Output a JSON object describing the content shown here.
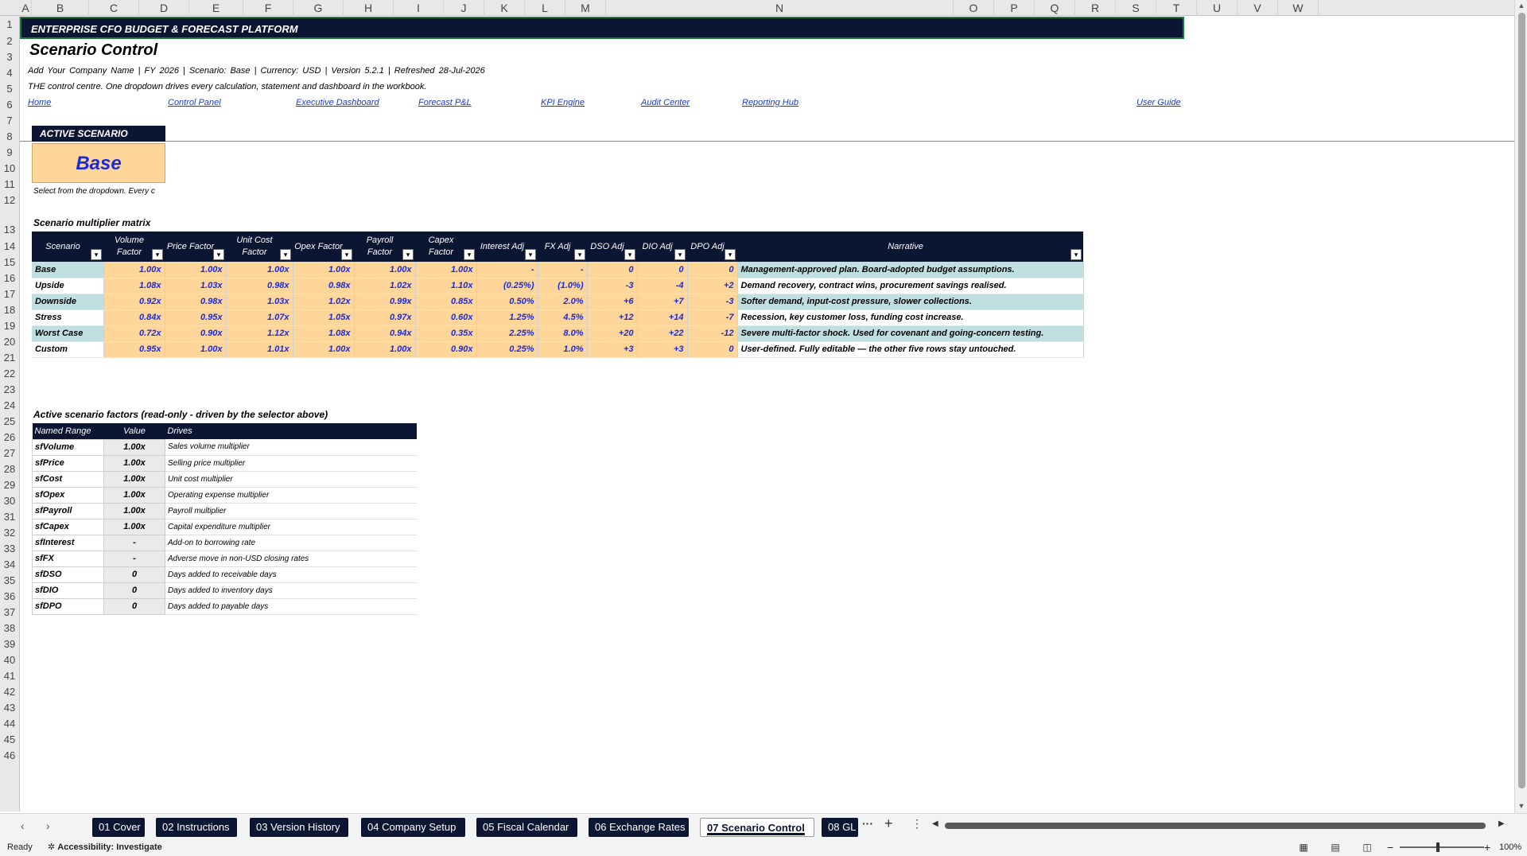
{
  "columns": [
    "A",
    "B",
    "C",
    "D",
    "E",
    "F",
    "G",
    "H",
    "I",
    "J",
    "K",
    "L",
    "M",
    "N",
    "O",
    "P",
    "Q",
    "R",
    "S",
    "T",
    "U",
    "V",
    "W"
  ],
  "rows": [
    "1",
    "2",
    "3",
    "4",
    "5",
    "6",
    "7",
    "8",
    "9",
    "10",
    "11",
    "12",
    "13",
    "14",
    "15",
    "16",
    "17",
    "18",
    "19",
    "20",
    "21",
    "22",
    "23",
    "24",
    "25",
    "26",
    "27",
    "28",
    "29",
    "30",
    "31",
    "32",
    "33",
    "34",
    "35",
    "36",
    "37",
    "38",
    "39",
    "40",
    "41",
    "42",
    "43",
    "44",
    "45",
    "46"
  ],
  "header": {
    "banner": "ENTERPRISE CFO BUDGET & FORECAST PLATFORM",
    "title": "Scenario Control",
    "meta": "Add Your Company Name   |   FY 2026   |   Scenario: Base   |   Currency: USD   |   Version 5.2.1   |   Refreshed 28-Jul-2026",
    "description": "THE control centre. One dropdown drives every calculation, statement and dashboard in the workbook."
  },
  "nav": [
    {
      "label": "Home"
    },
    {
      "label": "Control Panel"
    },
    {
      "label": "Executive Dashboard"
    },
    {
      "label": "Forecast P&L"
    },
    {
      "label": "KPI Engine"
    },
    {
      "label": "Audit Center"
    },
    {
      "label": "Reporting Hub"
    },
    {
      "label": "User Guide"
    }
  ],
  "active_scenario": {
    "label": "ACTIVE SCENARIO",
    "value": "Base",
    "hint": "Select from the dropdown. Every c"
  },
  "matrix": {
    "title": "Scenario multiplier matrix",
    "headers": [
      "Scenario",
      "Volume Factor",
      "Price Factor",
      "Unit Cost Factor",
      "Opex Factor",
      "Payroll Factor",
      "Capex Factor",
      "Interest Adj",
      "FX Adj",
      "DSO Adj",
      "DIO Adj",
      "DPO Adj",
      "Narrative"
    ],
    "rows": [
      {
        "cells": [
          "Base",
          "1.00x",
          "1.00x",
          "1.00x",
          "1.00x",
          "1.00x",
          "1.00x",
          "-",
          "-",
          "0",
          "0",
          "0",
          "Management-approved plan. Board-adopted budget assumptions."
        ]
      },
      {
        "cells": [
          "Upside",
          "1.08x",
          "1.03x",
          "0.98x",
          "0.98x",
          "1.02x",
          "1.10x",
          "(0.25%)",
          "(1.0%)",
          "-3",
          "-4",
          "+2",
          "Demand recovery, contract wins, procurement savings realised."
        ]
      },
      {
        "cells": [
          "Downside",
          "0.92x",
          "0.98x",
          "1.03x",
          "1.02x",
          "0.99x",
          "0.85x",
          "0.50%",
          "2.0%",
          "+6",
          "+7",
          "-3",
          "Softer demand, input-cost pressure, slower collections."
        ]
      },
      {
        "cells": [
          "Stress",
          "0.84x",
          "0.95x",
          "1.07x",
          "1.05x",
          "0.97x",
          "0.60x",
          "1.25%",
          "4.5%",
          "+12",
          "+14",
          "-7",
          "Recession, key customer loss, funding cost increase."
        ]
      },
      {
        "cells": [
          "Worst Case",
          "0.72x",
          "0.90x",
          "1.12x",
          "1.08x",
          "0.94x",
          "0.35x",
          "2.25%",
          "8.0%",
          "+20",
          "+22",
          "-12",
          "Severe multi-factor shock. Used for covenant and going-concern testing."
        ]
      },
      {
        "cells": [
          "Custom",
          "0.95x",
          "1.00x",
          "1.01x",
          "1.00x",
          "1.00x",
          "0.90x",
          "0.25%",
          "1.0%",
          "+3",
          "+3",
          "0",
          "User-defined. Fully editable — the other five rows stay untouched."
        ]
      }
    ]
  },
  "active_factors": {
    "title": "Active scenario factors (read-only - driven by the selector above)",
    "headers": [
      "Named Range",
      "Value",
      "Drives"
    ],
    "rows": [
      {
        "name": "sfVolume",
        "value": "1.00x",
        "drives": "Sales volume multiplier"
      },
      {
        "name": "sfPrice",
        "value": "1.00x",
        "drives": "Selling price multiplier"
      },
      {
        "name": "sfCost",
        "value": "1.00x",
        "drives": "Unit cost multiplier"
      },
      {
        "name": "sfOpex",
        "value": "1.00x",
        "drives": "Operating expense multiplier"
      },
      {
        "name": "sfPayroll",
        "value": "1.00x",
        "drives": "Payroll multiplier"
      },
      {
        "name": "sfCapex",
        "value": "1.00x",
        "drives": "Capital expenditure multiplier"
      },
      {
        "name": "sfInterest",
        "value": "-",
        "drives": "Add-on to borrowing rate"
      },
      {
        "name": "sfFX",
        "value": "-",
        "drives": "Adverse move in non-USD closing rates"
      },
      {
        "name": "sfDSO",
        "value": "0",
        "drives": "Days added to receivable days"
      },
      {
        "name": "sfDIO",
        "value": "0",
        "drives": "Days added to inventory days"
      },
      {
        "name": "sfDPO",
        "value": "0",
        "drives": "Days added to payable days"
      }
    ]
  },
  "sheets": [
    {
      "label": "01 Cover"
    },
    {
      "label": "02 Instructions"
    },
    {
      "label": "03 Version History"
    },
    {
      "label": "04 Company Setup"
    },
    {
      "label": "05 Fiscal Calendar"
    },
    {
      "label": "06 Exchange Rates"
    },
    {
      "label": "07 Scenario Control",
      "active": true
    },
    {
      "label": "08 GL"
    }
  ],
  "tabbar": {
    "more": "···",
    "add": "+",
    "menu": "⋮",
    "prev": "‹",
    "next": "›"
  },
  "status": {
    "ready": "Ready",
    "accessibility_label": "Accessibility: Investigate",
    "zoom": "100%"
  },
  "colors": {
    "navy": "#0b1633",
    "accent_blue": "#1a2ae0",
    "orange_fill": "#ffd699",
    "teal_fill": "#bfdfe0"
  }
}
